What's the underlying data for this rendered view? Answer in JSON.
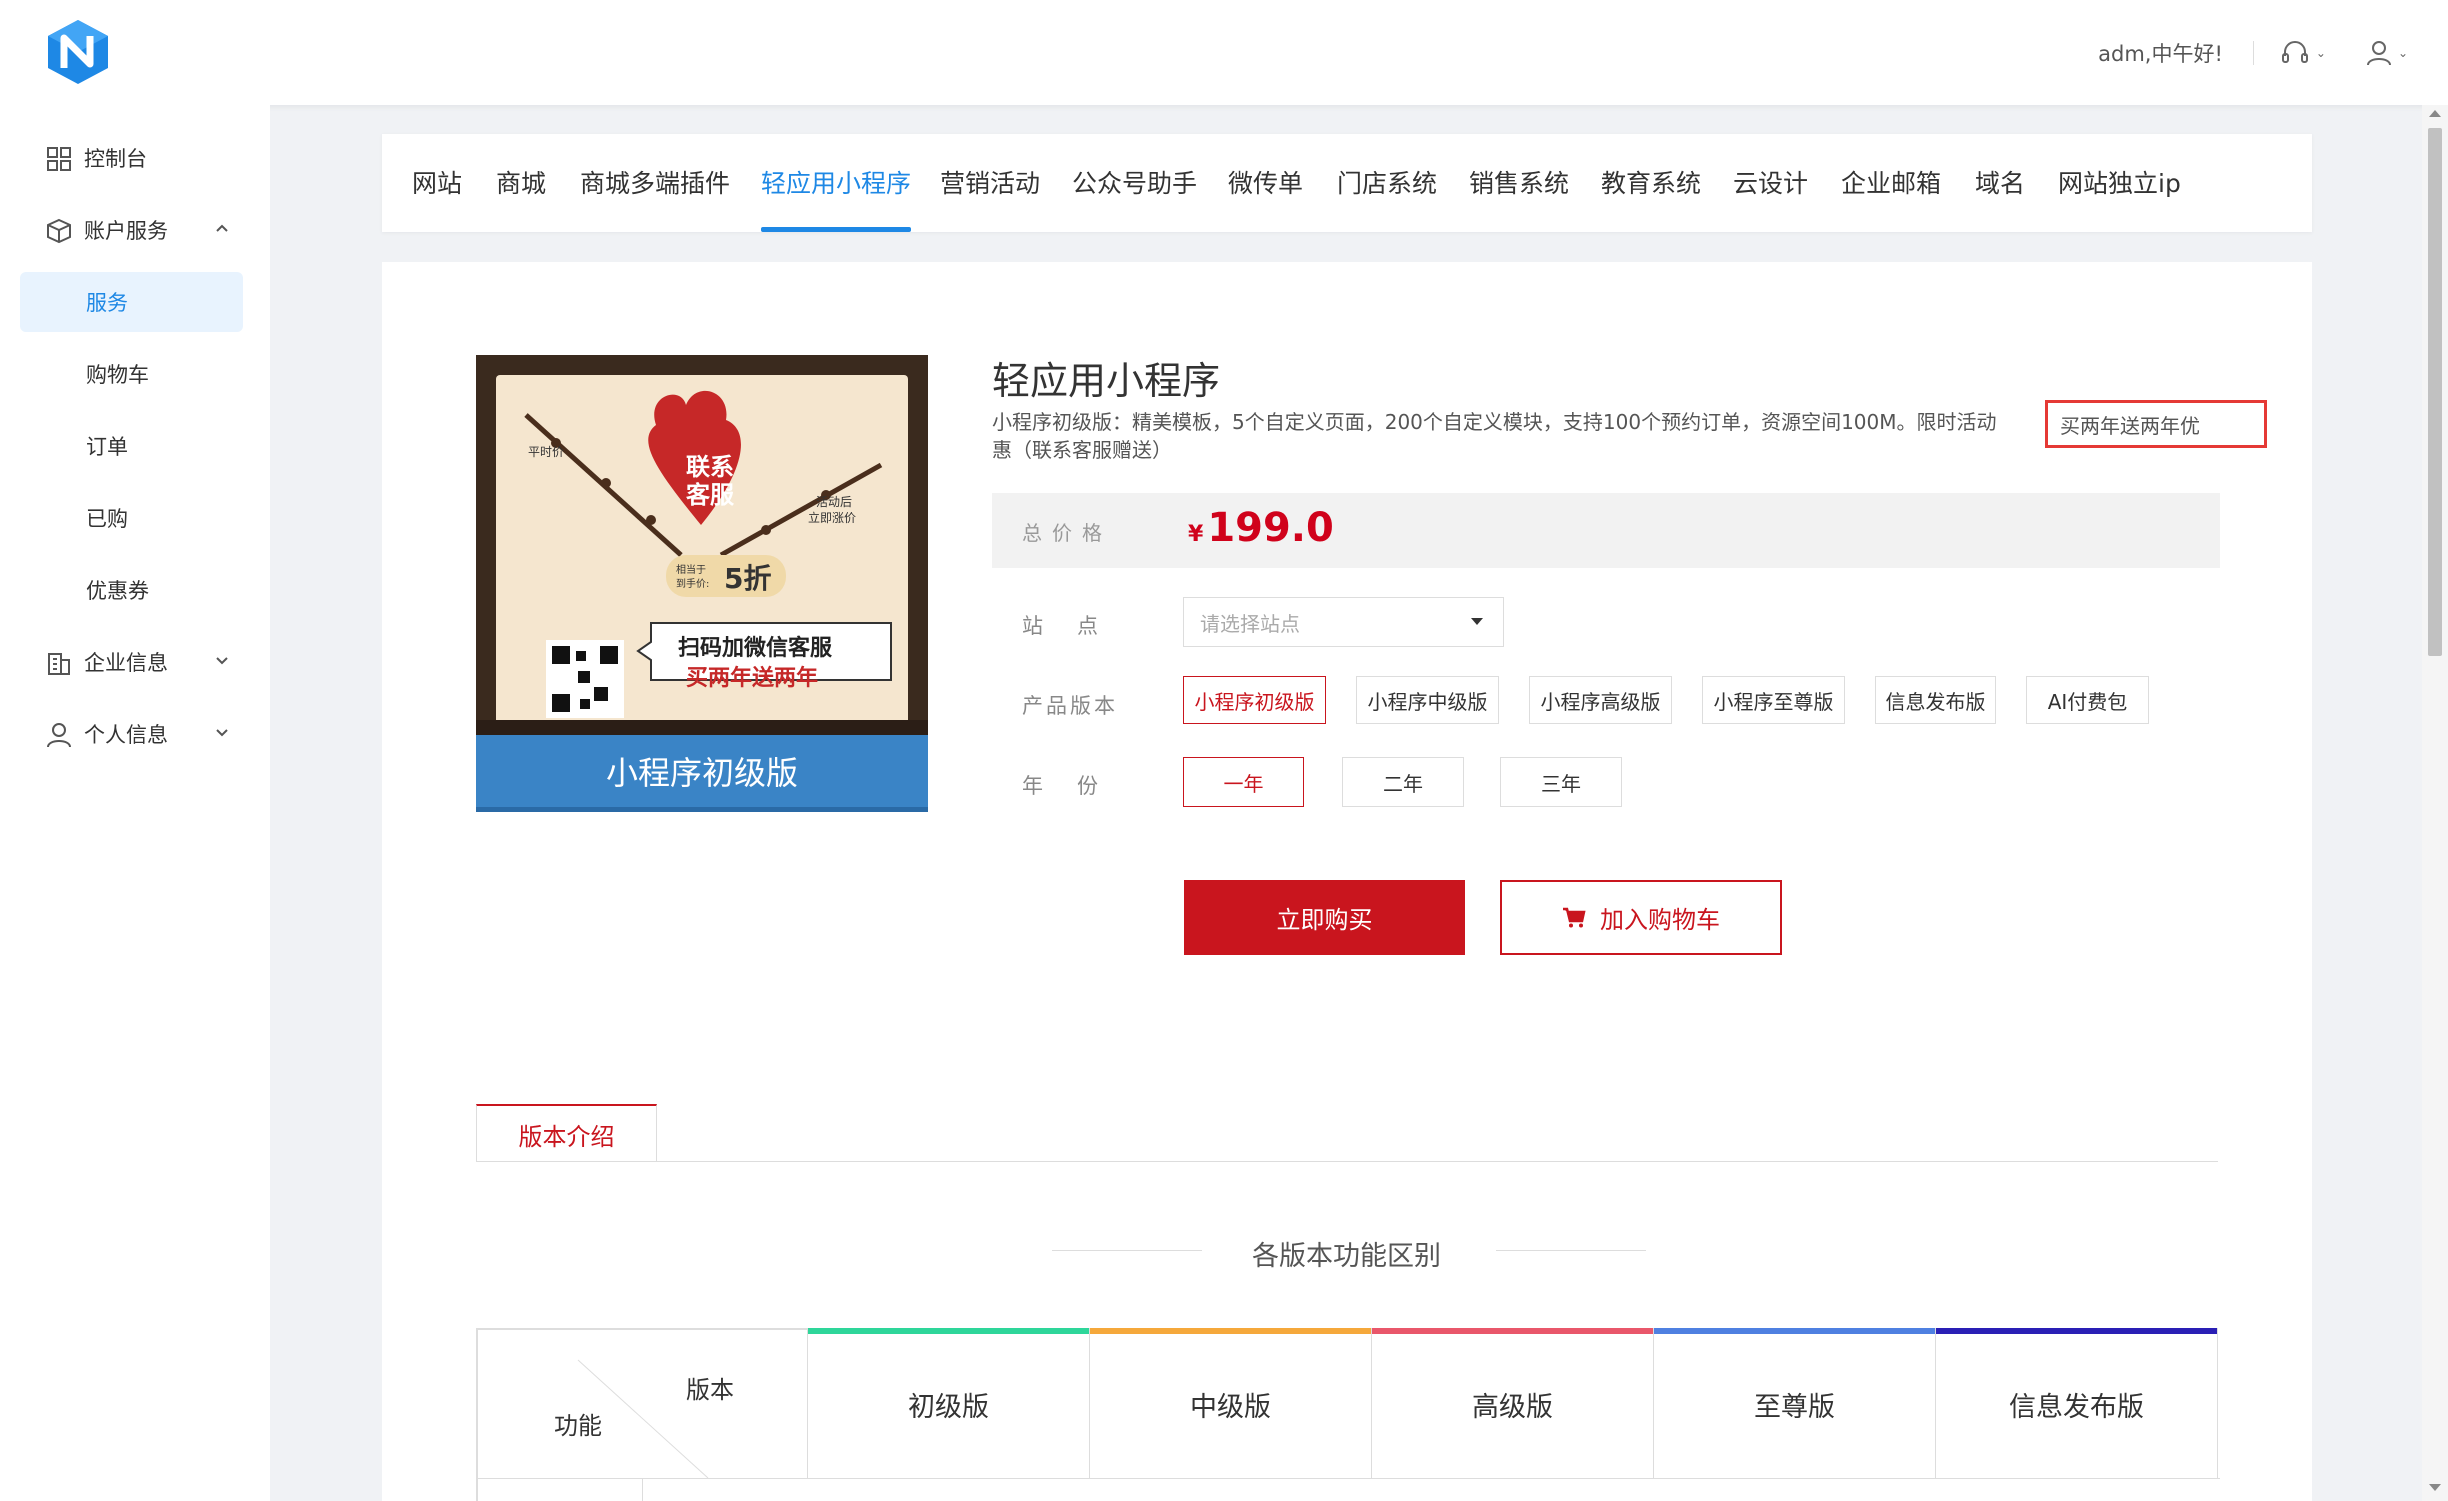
{
  "header": {
    "greeting": "adm,中午好!",
    "support_icon": "headset-icon",
    "user_icon": "user-icon"
  },
  "sidebar": {
    "items": [
      {
        "label": "控制台",
        "icon": "dashboard-icon"
      },
      {
        "label": "账户服务",
        "icon": "cube-icon"
      },
      {
        "label": "企业信息",
        "icon": "building-icon"
      },
      {
        "label": "个人信息",
        "icon": "person-icon"
      }
    ],
    "sub_items": [
      {
        "label": "服务"
      },
      {
        "label": "购物车"
      },
      {
        "label": "订单"
      },
      {
        "label": "已购"
      },
      {
        "label": "优惠券"
      }
    ]
  },
  "nav": {
    "tabs": [
      "网站",
      "商城",
      "商城多端插件",
      "轻应用小程序",
      "营销活动",
      "公众号助手",
      "微传单",
      "门店系统",
      "销售系统",
      "教育系统",
      "云设计",
      "企业邮箱",
      "域名",
      "网站独立ip"
    ],
    "active": "轻应用小程序"
  },
  "product": {
    "image_caption": "小程序初级版",
    "image_texts": {
      "badge1": "联系",
      "badge2": "客服",
      "left_tag": "平时价",
      "right_tag1": "活动后",
      "right_tag2": "立即涨价",
      "discount_small1": "相当于",
      "discount_small2": "到手价:",
      "discount": "5折",
      "qr_line1": "扫码加微信客服",
      "qr_line2": "买两年送两年"
    },
    "title": "轻应用小程序",
    "desc": "小程序初级版：精美模板，5个自定义页面，200个自定义模块，支持100个预约订单，资源空间100M。限时活动",
    "desc_highlight": "买两年送两年优",
    "desc_line2": "惠（联系客服赠送）",
    "price_label": "总价格",
    "currency": "¥",
    "price": "199.0",
    "site_label": "站点",
    "site_placeholder": "请选择站点",
    "version_label": "产品版本",
    "versions": [
      "小程序初级版",
      "小程序中级版",
      "小程序高级版",
      "小程序至尊版",
      "信息发布版",
      "AI付费包"
    ],
    "year_label": "年份",
    "years": [
      "一年",
      "二年",
      "三年"
    ],
    "buy_label": "立即购买",
    "cart_label": "加入购物车"
  },
  "details": {
    "tab_label": "版本介绍",
    "section_title": "各版本功能区别",
    "diag_top": "版本",
    "diag_bottom": "功能",
    "columns": [
      {
        "label": "初级版",
        "color": "#2ed69a"
      },
      {
        "label": "中级版",
        "color": "#f5a83b"
      },
      {
        "label": "高级版",
        "color": "#e9576b"
      },
      {
        "label": "至尊版",
        "color": "#4f80e1"
      },
      {
        "label": "信息发布版",
        "color": "#2a1fb5"
      }
    ]
  },
  "colors": {
    "accent": "#1e88e5",
    "brand_red": "#c9151e"
  }
}
